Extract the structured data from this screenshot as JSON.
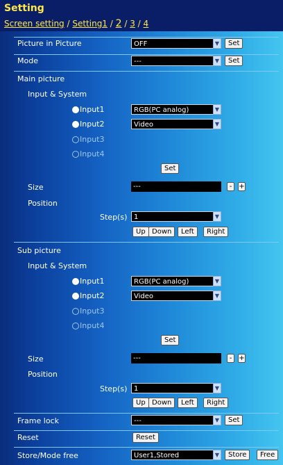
{
  "header": {
    "title": "Setting",
    "breadcrumb": {
      "screen_setting": "Screen setting",
      "sep1": " / ",
      "setting1": "Setting1",
      "sep2": " / ",
      "p2": "2",
      "sep3": " / ",
      "p3": "3",
      "sep4": " / ",
      "p4": "4"
    }
  },
  "rows": {
    "pip": {
      "label": "Picture in Picture",
      "value": "OFF",
      "set": "Set"
    },
    "mode": {
      "label": "Mode",
      "value": "---",
      "set": "Set"
    }
  },
  "main_picture": {
    "label": "Main picture",
    "input_system": "Input & System",
    "inputs": [
      {
        "label": "Input1",
        "selected": true,
        "value": "RGB(PC analog)"
      },
      {
        "label": "Input2",
        "selected": true,
        "value": "Video"
      },
      {
        "label": "Input3",
        "selected": false
      },
      {
        "label": "Input4",
        "selected": false
      }
    ],
    "set": "Set",
    "size_label": "Size",
    "size_value": "---",
    "minus": "-",
    "plus": "+",
    "position_label": "Position",
    "steps_label": "Step(s)",
    "steps_value": "1",
    "buttons": {
      "up": "Up",
      "down": "Down",
      "left": "Left",
      "right": "Right"
    }
  },
  "sub_picture": {
    "label": "Sub picture",
    "input_system": "Input & System",
    "inputs": [
      {
        "label": "Input1",
        "selected": true,
        "value": "RGB(PC analog)"
      },
      {
        "label": "Input2",
        "selected": true,
        "value": "Video"
      },
      {
        "label": "Input3",
        "selected": false
      },
      {
        "label": "Input4",
        "selected": false
      }
    ],
    "set": "Set",
    "size_label": "Size",
    "size_value": "---",
    "minus": "-",
    "plus": "+",
    "position_label": "Position",
    "steps_label": "Step(s)",
    "steps_value": "1",
    "buttons": {
      "up": "Up",
      "down": "Down",
      "left": "Left",
      "right": "Right"
    }
  },
  "frame_lock": {
    "label": "Frame lock",
    "value": "---",
    "set": "Set"
  },
  "reset": {
    "label": "Reset",
    "button": "Reset"
  },
  "store": {
    "label": "Store/Mode free",
    "value": "User1,Stored",
    "store": "Store",
    "free": "Free"
  },
  "icons": {
    "dropdown": "chevron-down-icon"
  },
  "colors": {
    "title": "#ffe84a",
    "header_bg": "#0a1e68"
  }
}
